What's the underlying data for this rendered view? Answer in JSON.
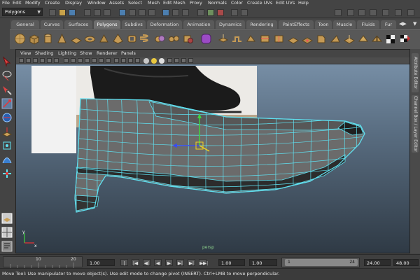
{
  "menu": [
    "File",
    "Edit",
    "Modify",
    "Create",
    "Display",
    "Window",
    "Assets",
    "Select",
    "Mesh",
    "Edit Mesh",
    "Proxy",
    "Normals",
    "Color",
    "Create UVs",
    "Edit UVs",
    "Help"
  ],
  "status_line": {
    "mode": "Polygons"
  },
  "shelf_tabs": [
    "General",
    "Curves",
    "Surfaces",
    "Polygons",
    "Subdivs",
    "Deformation",
    "Animation",
    "Dynamics",
    "Rendering",
    "PaintEffects",
    "Toon",
    "Muscle",
    "Fluids",
    "Fur"
  ],
  "active_shelf_tab": "Polygons",
  "viewport_menu": [
    "View",
    "Shading",
    "Lighting",
    "Show",
    "Renderer",
    "Panels"
  ],
  "viewport": {
    "camera_label": "persp",
    "axis_y": "y",
    "axis_x": "x"
  },
  "right_panel_tabs": [
    "Attribute Editor",
    "Channel Box / Layer Editor"
  ],
  "timeline": {
    "tick_labels": [
      "10",
      "20"
    ],
    "current_time": "1.00",
    "start_time": "1.00",
    "range_start": "1.00",
    "range_marker": "1",
    "range_end_marker": "24",
    "end_time": "24.00",
    "total_end": "48.00"
  },
  "playback_buttons": [
    "|◀◀",
    "|◀",
    "◀|",
    "◀",
    "▶",
    "▶|",
    "▶|",
    "▶▶|"
  ],
  "help_line": "Move Tool: Use manipulator to move object(s). Use edit mode to change pivot (INSERT).  Ctrl+LMB to move perpendicular.",
  "colors": {
    "wire": "#5fe0f0",
    "bg_top": "#7d95ad",
    "bg_bottom": "#2f3a45"
  }
}
